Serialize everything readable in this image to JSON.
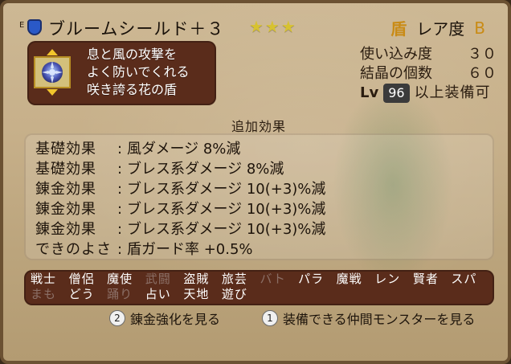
{
  "header": {
    "equip_flag": "E",
    "item_name": "ブルームシールド＋３",
    "stars": "★★★",
    "rarity_icon": "盾",
    "rarity_label": "レア度",
    "rarity_rank": "B"
  },
  "item": {
    "icon": "bloom-shield-icon",
    "description_lines": [
      "息と風の攻撃を",
      "よく防いでくれる",
      "咲き誇る花の盾"
    ]
  },
  "stats": {
    "usage_label": "使い込み度",
    "usage_value": "３０",
    "crystal_label": "結晶の個数",
    "crystal_value": "６０",
    "lv_label": "Lv",
    "lv_value": "96",
    "lv_suffix": "以上装備可"
  },
  "effects": {
    "title": "追加効果",
    "rows": [
      {
        "type": "基礎効果",
        "text": "風ダメージ 8%減"
      },
      {
        "type": "基礎効果",
        "text": "ブレス系ダメージ 8%減"
      },
      {
        "type": "錬金効果",
        "text": "ブレス系ダメージ 10(+3)%減"
      },
      {
        "type": "錬金効果",
        "text": "ブレス系ダメージ 10(+3)%減"
      },
      {
        "type": "錬金効果",
        "text": "ブレス系ダメージ 10(+3)%減"
      },
      {
        "type": "できのよさ",
        "text": "盾ガード率 +0.5%"
      }
    ]
  },
  "jobs": {
    "row1": [
      {
        "name": "戦士",
        "enabled": true
      },
      {
        "name": "僧侶",
        "enabled": true
      },
      {
        "name": "魔使",
        "enabled": true
      },
      {
        "name": "武闘",
        "enabled": false
      },
      {
        "name": "盗賊",
        "enabled": true
      },
      {
        "name": "旅芸",
        "enabled": true
      },
      {
        "name": "バト",
        "enabled": false
      },
      {
        "name": "パラ",
        "enabled": true
      },
      {
        "name": "魔戦",
        "enabled": true
      },
      {
        "name": "レン",
        "enabled": true
      },
      {
        "name": "賢者",
        "enabled": true
      },
      {
        "name": "スパ",
        "enabled": true
      }
    ],
    "row2": [
      {
        "name": "まも",
        "enabled": false
      },
      {
        "name": "どう",
        "enabled": true
      },
      {
        "name": "踊り",
        "enabled": false
      },
      {
        "name": "占い",
        "enabled": true
      },
      {
        "name": "天地",
        "enabled": true
      },
      {
        "name": "遊び",
        "enabled": true
      }
    ]
  },
  "footer": {
    "hint_alchemy_button": "2",
    "hint_alchemy_label": "錬金強化を見る",
    "hint_monsters_button": "1",
    "hint_monsters_label": "装備できる仲間モンスターを見る"
  },
  "colors": {
    "accent_gold": "#c98b15",
    "panel_brown": "#5a2c1b",
    "parchment": "#c7b08a",
    "disabled_job": "#8b6f66"
  }
}
